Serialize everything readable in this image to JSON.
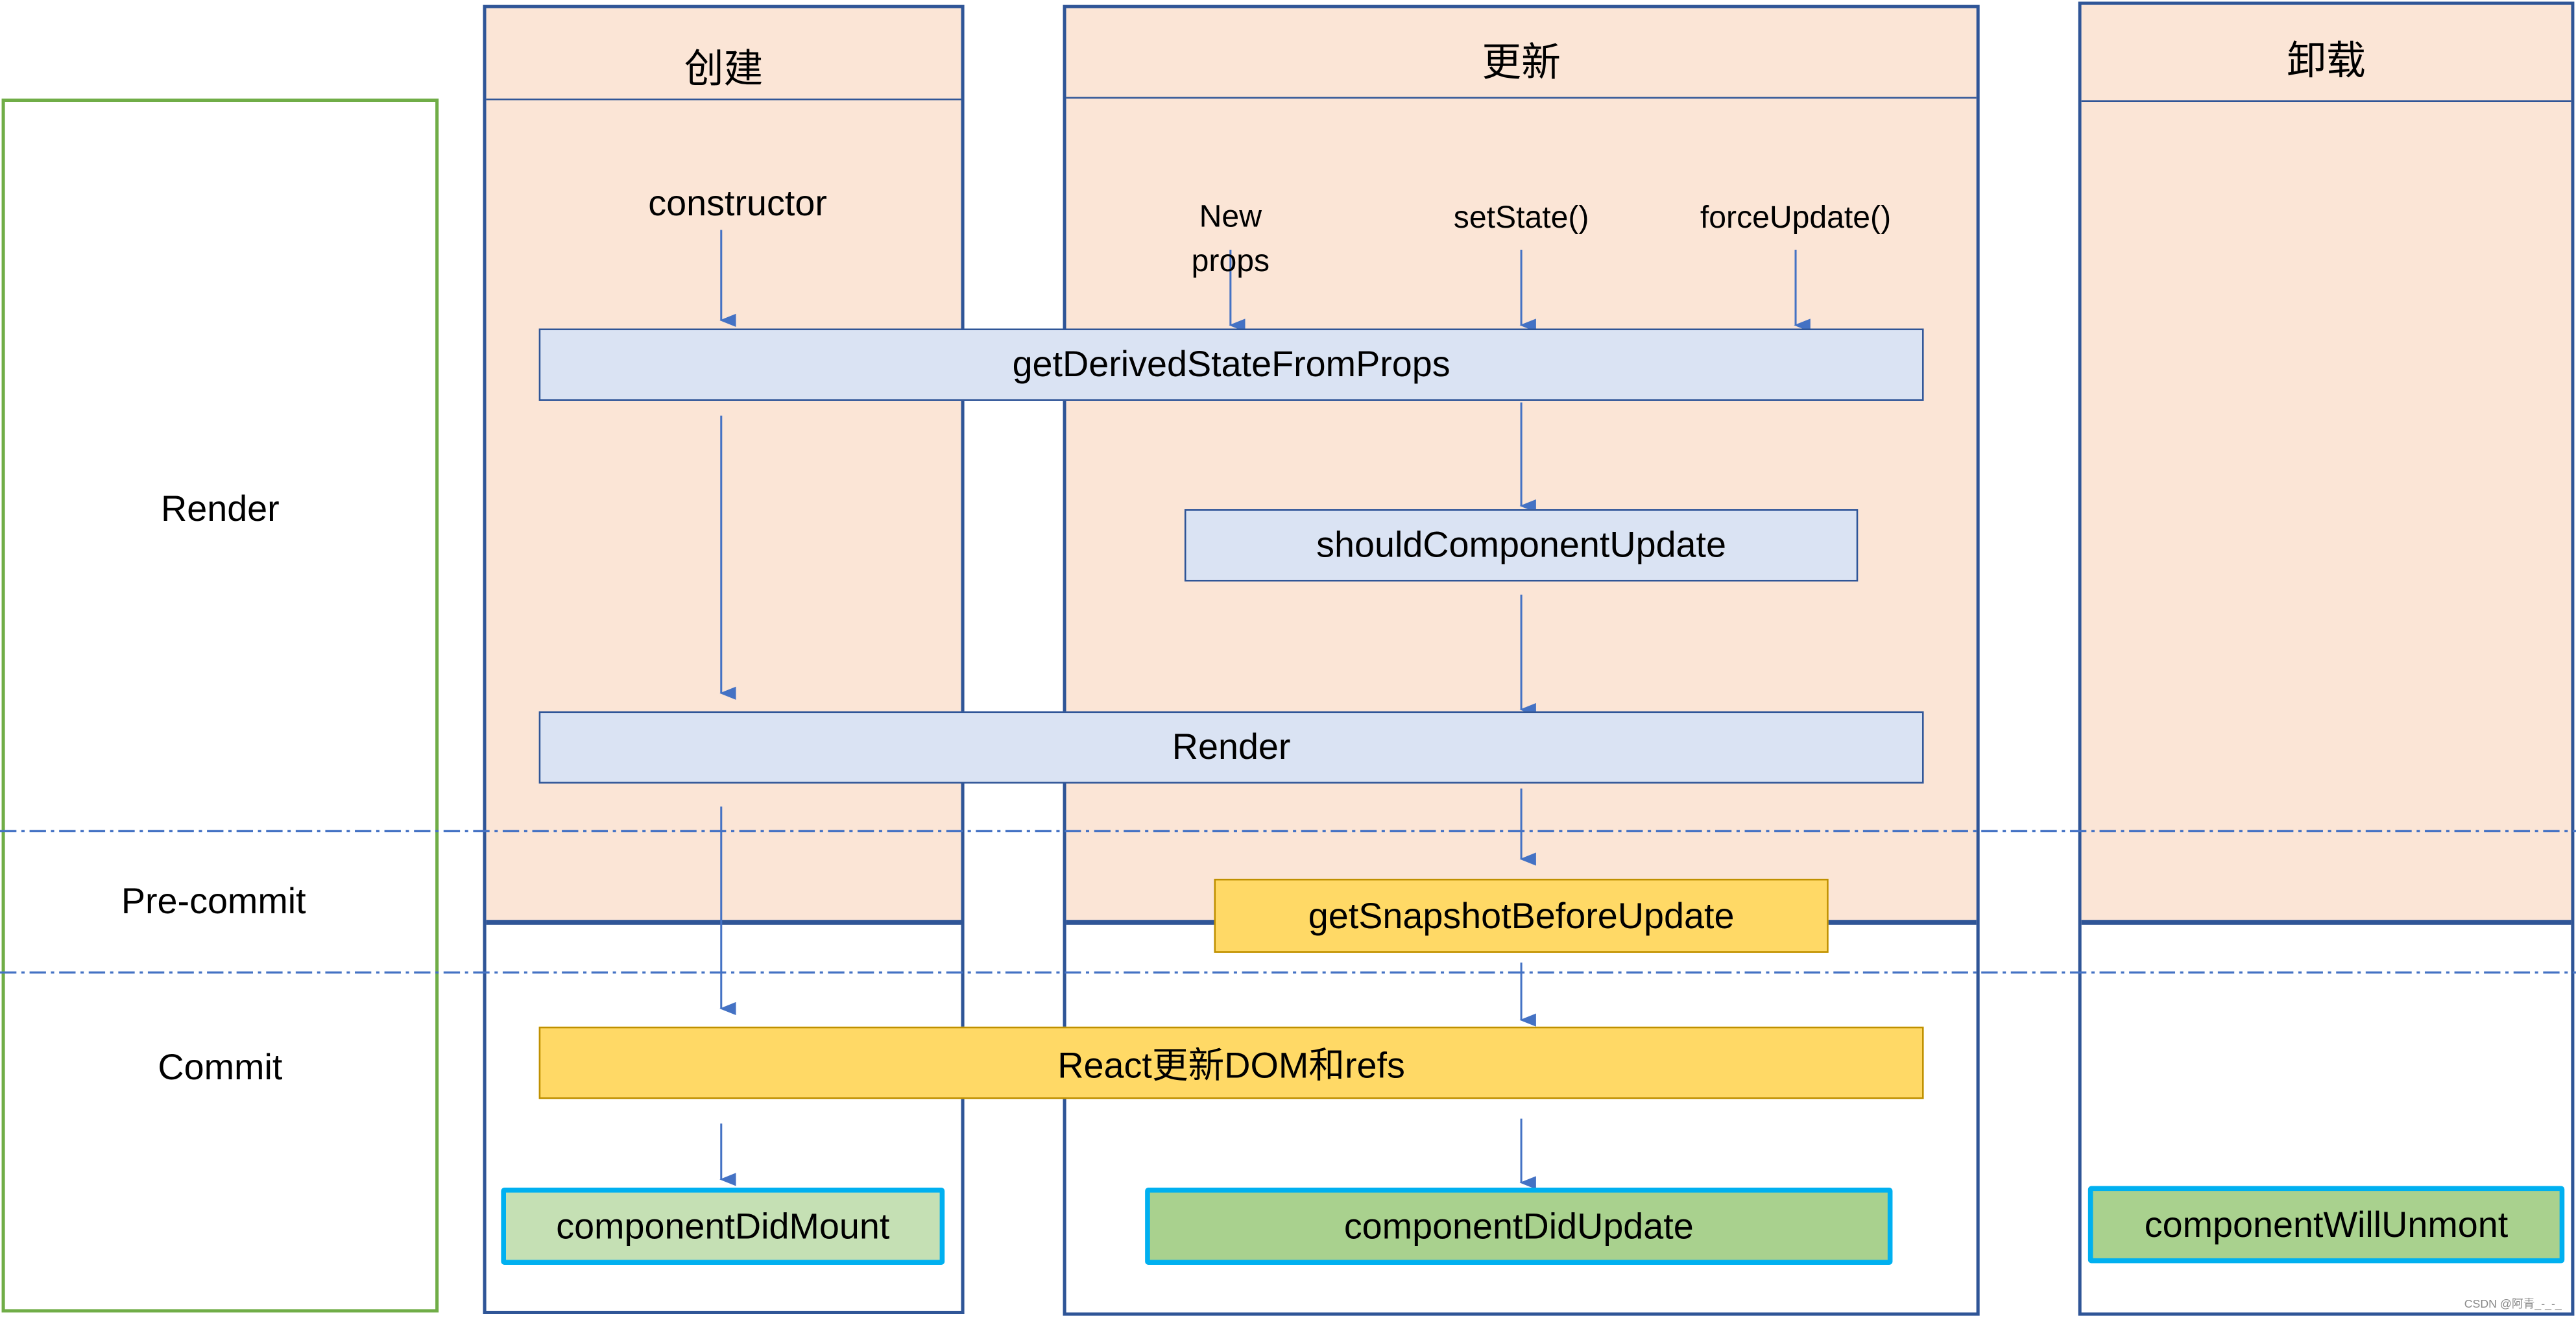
{
  "phases": {
    "render": "Render",
    "precommit": "Pre-commit",
    "commit": "Commit"
  },
  "columns": {
    "create": "创建",
    "update": "更新",
    "unmount": "卸载"
  },
  "triggers": {
    "constructor": "constructor",
    "new_props_1": "New",
    "new_props_2": "props",
    "set_state": "setState()",
    "force_update": "forceUpdate()"
  },
  "methods": {
    "gdsfp": "getDerivedStateFromProps",
    "scu": "shouldComponentUpdate",
    "render": "Render",
    "gsbu": "getSnapshotBeforeUpdate",
    "react_update": "React更新DOM和refs",
    "cdm": "componentDidMount",
    "cdu": "componentDidUpdate",
    "cwu": "componentWillUnmont"
  },
  "watermark": "CSDN @阿青_-_-_",
  "colors": {
    "peach": "#fbe5d6",
    "blue_box": "#dae3f3",
    "yellow_box": "#ffd966",
    "green_light": "#c5e0b4",
    "green": "#a9d18e",
    "highlight_border": "#00b0f0",
    "frame": "#2f5597",
    "phase_frame": "#70ad47",
    "arrow": "#4472c4"
  }
}
